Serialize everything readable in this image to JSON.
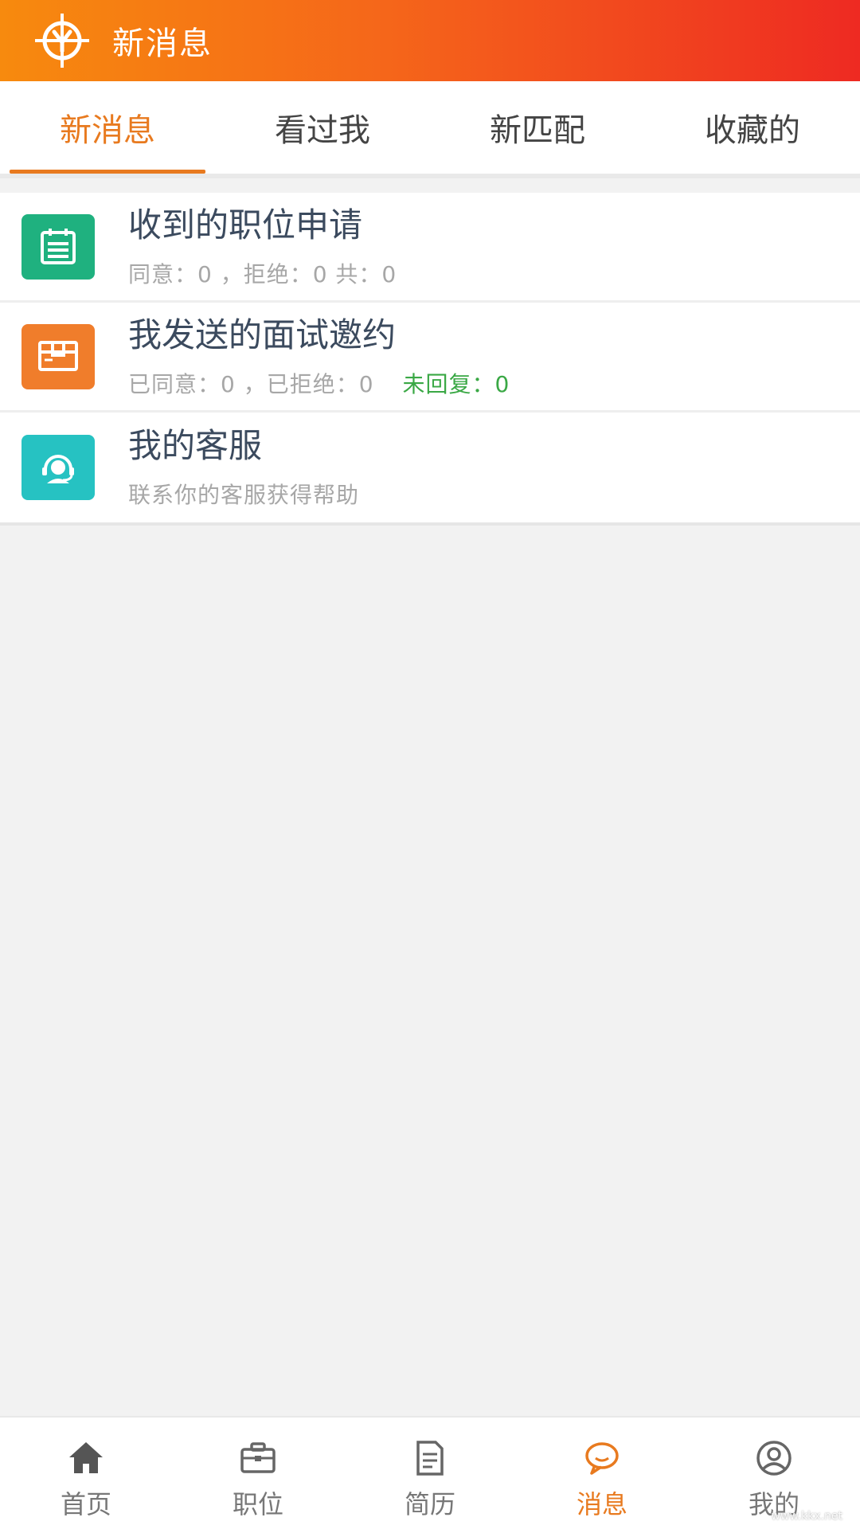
{
  "header": {
    "title": "新消息",
    "logo_icon": "crosshair-y-logo"
  },
  "tabs": [
    {
      "label": "新消息",
      "active": true
    },
    {
      "label": "看过我",
      "active": false
    },
    {
      "label": "新匹配",
      "active": false
    },
    {
      "label": "收藏的",
      "active": false
    }
  ],
  "list": [
    {
      "title": "收到的职位申请",
      "sub": "同意：0 ，拒绝：0 共：0",
      "icon": "clipboard-icon",
      "icon_color": "#1fb17f"
    },
    {
      "title": "我发送的面试邀约",
      "sub": "已同意：0 ，已拒绝：0",
      "sub_pending": "未回复：0",
      "icon": "box-icon",
      "icon_color": "#f07d2b"
    },
    {
      "title": "我的客服",
      "sub": "联系你的客服获得帮助",
      "icon": "headset-support-icon",
      "icon_color": "#26c2c2"
    }
  ],
  "nav": [
    {
      "label": "首页",
      "icon": "home-icon",
      "active": false
    },
    {
      "label": "职位",
      "icon": "briefcase-icon",
      "active": false
    },
    {
      "label": "简历",
      "icon": "document-icon",
      "active": false
    },
    {
      "label": "消息",
      "icon": "chat-bubble-icon",
      "active": true
    },
    {
      "label": "我的",
      "icon": "user-circle-icon",
      "active": false
    }
  ],
  "colors": {
    "accent": "#e87a1f",
    "pending_green": "#3aa845"
  },
  "watermark": "www.kkx.net"
}
